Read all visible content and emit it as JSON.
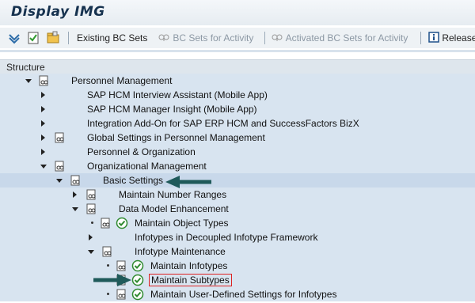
{
  "window": {
    "title": "Display IMG"
  },
  "toolbar": {
    "items": [
      {
        "label": "Existing BC Sets",
        "enabled": true
      },
      {
        "label": "BC Sets for Activity",
        "enabled": false
      },
      {
        "label": "Activated BC Sets for Activity",
        "enabled": false
      },
      {
        "label": "Release",
        "enabled": true
      }
    ]
  },
  "tree": {
    "header": "Structure",
    "nodes": [
      {
        "label": "Personnel Management",
        "level": 0,
        "state": "expanded",
        "doc": true
      },
      {
        "label": "SAP HCM Interview Assistant (Mobile App)",
        "level": 1,
        "state": "collapsed",
        "doc": false
      },
      {
        "label": "SAP HCM Manager Insight (Mobile App)",
        "level": 1,
        "state": "collapsed",
        "doc": false
      },
      {
        "label": "Integration Add-On for SAP ERP HCM and SuccessFactors BizX",
        "level": 1,
        "state": "collapsed",
        "doc": false
      },
      {
        "label": "Global Settings in Personnel Management",
        "level": 1,
        "state": "collapsed",
        "doc": true
      },
      {
        "label": "Personnel & Organization",
        "level": 1,
        "state": "collapsed",
        "doc": false
      },
      {
        "label": "Organizational Management",
        "level": 1,
        "state": "expanded",
        "doc": true
      },
      {
        "label": "Basic Settings",
        "level": 2,
        "state": "expanded",
        "doc": true
      },
      {
        "label": "Maintain Number Ranges",
        "level": 3,
        "state": "collapsed",
        "doc": true
      },
      {
        "label": "Data Model Enhancement",
        "level": 3,
        "state": "expanded",
        "doc": true
      },
      {
        "label": "Maintain Object Types",
        "level": 4,
        "state": "leaf",
        "doc": true,
        "activity": true
      },
      {
        "label": "Infotypes in Decoupled Infotype Framework",
        "level": 4,
        "state": "collapsed",
        "doc": false
      },
      {
        "label": "Infotype Maintenance",
        "level": 4,
        "state": "expanded",
        "doc": true
      },
      {
        "label": "Maintain Infotypes",
        "level": 5,
        "state": "leaf",
        "doc": true,
        "activity": true
      },
      {
        "label": "Maintain Subtypes",
        "level": 5,
        "state": "leaf",
        "doc": true,
        "activity": true,
        "highlighted": true
      },
      {
        "label": "Maintain User-Defined Settings for Infotypes",
        "level": 5,
        "state": "leaf",
        "doc": true,
        "activity": true
      }
    ]
  },
  "colors": {
    "selection_blue": "#d8e4f0",
    "annotation_arrow": "#1f5a5a",
    "highlight_box": "#dd2222"
  },
  "icons": [
    "choose-icon",
    "execute-icon",
    "folder-icon",
    "bc-set-icon",
    "info-icon",
    "document-icon",
    "activity-check-icon"
  ]
}
